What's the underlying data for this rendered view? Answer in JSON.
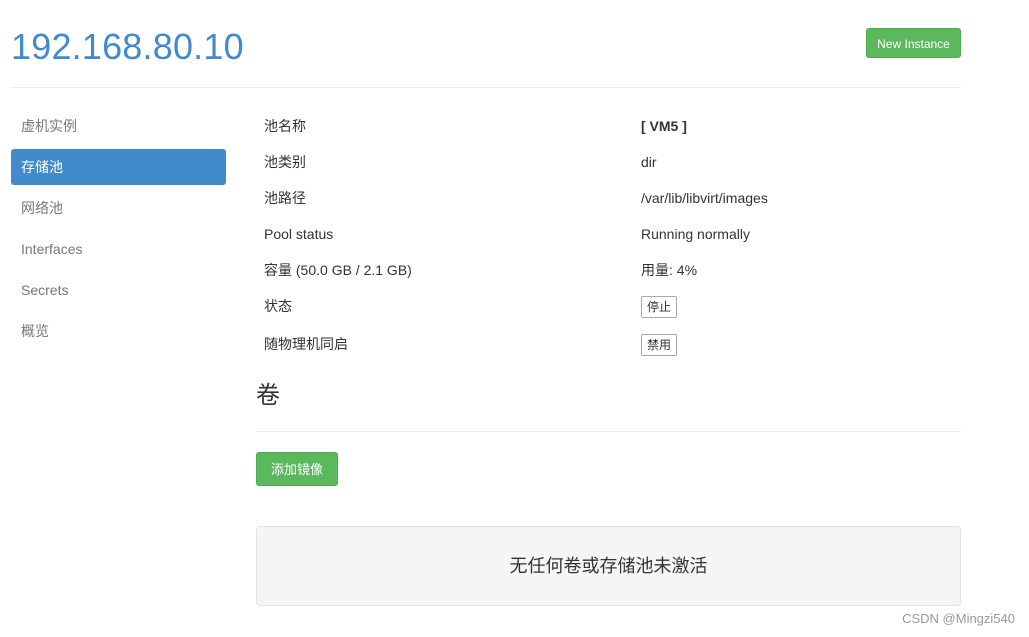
{
  "header": {
    "host": "192.168.80.10",
    "new_instance_label": "New Instance"
  },
  "sidebar": {
    "items": [
      {
        "label": "虚机实例",
        "active": false
      },
      {
        "label": "存储池",
        "active": true
      },
      {
        "label": "网络池",
        "active": false
      },
      {
        "label": "Interfaces",
        "active": false
      },
      {
        "label": "Secrets",
        "active": false
      },
      {
        "label": "概览",
        "active": false
      }
    ]
  },
  "pool": {
    "name_label": "池名称",
    "name_value": "[ VM5 ]",
    "type_label": "池类别",
    "type_value": "dir",
    "path_label": "池路径",
    "path_value": "/var/lib/libvirt/images",
    "status_label": "Pool status",
    "status_value": "Running normally",
    "capacity_label": "容量 (50.0 GB / 2.1 GB)",
    "usage_value": "用量: 4%",
    "state_label": "状态",
    "state_button": "停止",
    "autostart_label": "随物理机同启",
    "autostart_button": "禁用"
  },
  "volumes": {
    "title": "卷",
    "add_image_label": "添加镜像",
    "empty_message": "无任何卷或存储池未激活"
  },
  "watermark": "CSDN @Mingzi540"
}
